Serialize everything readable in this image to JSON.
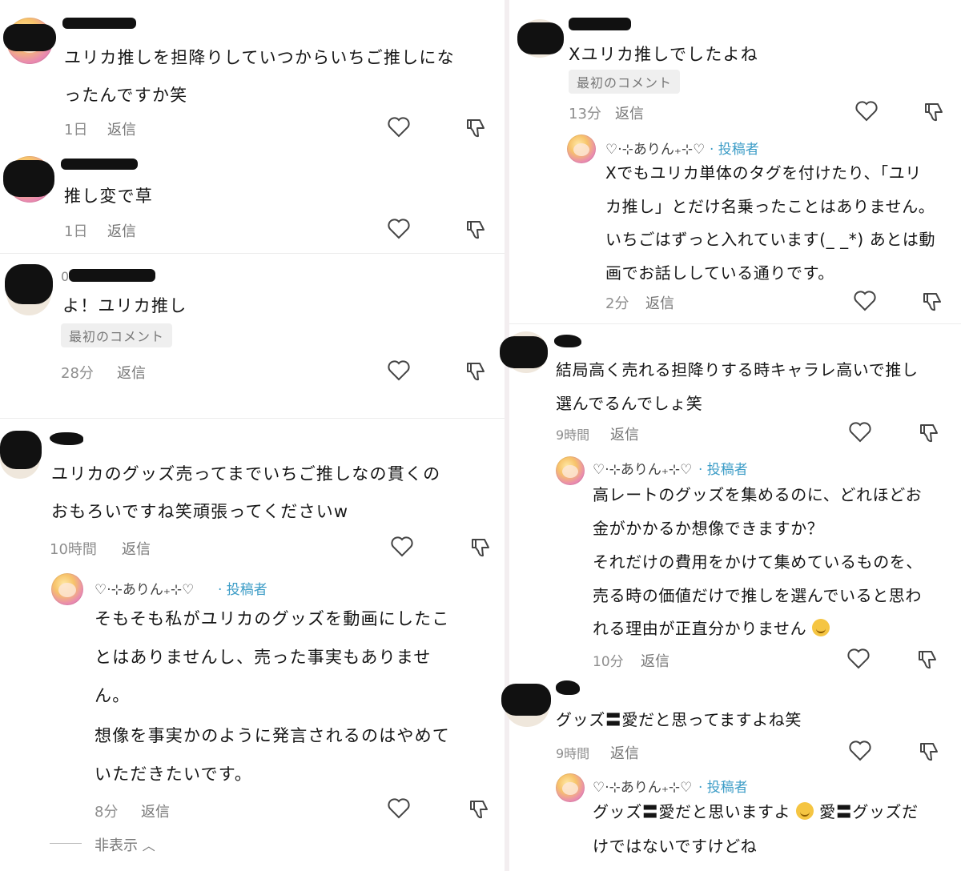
{
  "left": {
    "comments": [
      {
        "text1": "ユリカ推しを担降りしていつからいちご推しにな",
        "text2": "ったんですか笑",
        "time": "1日",
        "reply": "返信"
      },
      {
        "text1": "推し変で草",
        "time": "1日",
        "reply": "返信"
      },
      {
        "name_partial": "0",
        "text1": "よ！ユリカ推し",
        "badge": "最初のコメント",
        "time": "28分",
        "reply": "返信"
      },
      {
        "text1": "ユリカのグッズ売ってまでいちご推しなの貫くの",
        "text2": "おもろいですね笑頑張ってくださいw",
        "time": "10時間",
        "reply": "返信"
      }
    ],
    "author_reply": {
      "name": "♡·⊹ありん₊⊹♡",
      "tag": "· 投稿者",
      "lines": [
        "そもそも私がユリカのグッズを動画にしたこ",
        "とはありませんし、売った事実もありませ",
        "ん。",
        "想像を事実かのように発言されるのはやめて",
        "いただきたいです。"
      ],
      "time": "8分",
      "reply": "返信"
    },
    "hide": "非表示"
  },
  "right": {
    "c1": {
      "text1": "Xユリカ推しでしたよね",
      "badge": "最初のコメント",
      "time": "13分",
      "reply": "返信"
    },
    "r1": {
      "name": "♡·⊹ありん₊⊹♡",
      "tag": "· 投稿者",
      "lines": [
        "Xでもユリカ単体のタグを付けたり、「ユリ",
        "カ推し」とだけ名乗ったことはありません。",
        "いちごはずっと入れています(_ _*) あとは動",
        "画でお話ししている通りです。"
      ],
      "time": "2分",
      "reply": "返信"
    },
    "c2": {
      "text1": "結局高く売れる担降りする時キャラレ高いで推し",
      "text2": "選んでるんでしょ笑",
      "time": "9時間",
      "reply": "返信"
    },
    "r2": {
      "name": "♡·⊹ありん₊⊹♡",
      "tag": "· 投稿者",
      "lines": [
        "高レートのグッズを集めるのに、どれほどお",
        "金がかかるか想像できますか？",
        "それだけの費用をかけて集めているものを、",
        "売る時の価値だけで推しを選んでいると思わ",
        "れる理由が正直分かりません"
      ],
      "time": "10分",
      "reply": "返信"
    },
    "c3": {
      "text1": "グッズ〓愛だと思ってますよね笑",
      "time": "9時間",
      "reply": "返信"
    },
    "r3": {
      "name": "♡·⊹ありん₊⊹♡",
      "tag": "· 投稿者",
      "line1a": "グッズ〓愛だと思いますよ",
      "line1b": "愛〓グッズだ",
      "line2": "けではないですけどね"
    }
  }
}
